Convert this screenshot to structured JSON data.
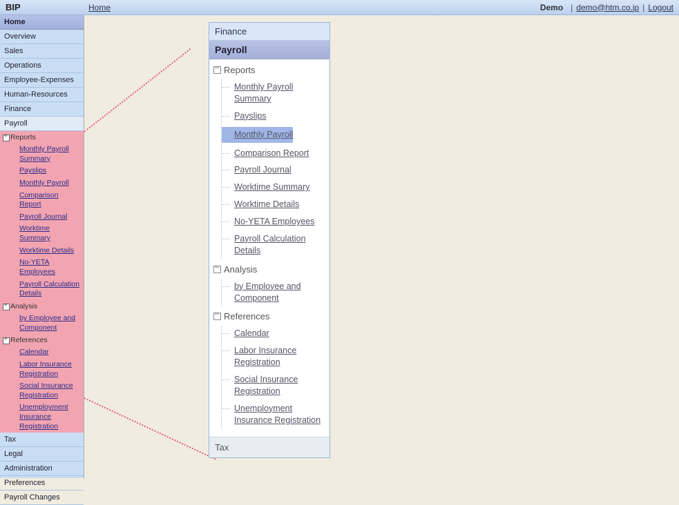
{
  "header": {
    "app_title": "BIP",
    "home_link": "Home",
    "user_name": "Demo",
    "email": "demo@htm.co.jp",
    "logout": "Logout"
  },
  "sidebar": {
    "home_label": "Home",
    "items": [
      "Overview",
      "Sales",
      "Operations",
      "Employee-Expenses",
      "Human-Resources",
      "Finance",
      "Payroll"
    ],
    "payroll_sub": {
      "reports": {
        "title": "Reports",
        "links": [
          "Monthly Payroll Summary",
          "Payslips",
          "Monthly Payroll",
          "Comparison Report",
          "Payroll Journal",
          "Worktime Summary",
          "Worktime Details",
          "No-YETA Employees",
          "Payroll Calculation Details"
        ]
      },
      "analysis": {
        "title": "Analysis",
        "links": [
          "by Employee and Component"
        ]
      },
      "references": {
        "title": "References",
        "links": [
          "Calendar",
          "Labor Insurance Registration",
          "Social Insurance Registration",
          "Unemployment Insurance Registration"
        ]
      }
    },
    "tail_items": [
      "Tax",
      "Legal",
      "Administration",
      "Preferences",
      "Payroll Changes"
    ]
  },
  "panel": {
    "finance_label": "Finance",
    "payroll_label": "Payroll",
    "reports": {
      "title": "Reports",
      "links": [
        "Monthly Payroll Summary",
        "Payslips",
        "Monthly Payroll",
        "Comparison Report",
        "Payroll Journal",
        "Worktime Summary",
        "Worktime Details",
        "No-YETA Employees",
        "Payroll Calculation Details"
      ],
      "highlighted_index": 2
    },
    "analysis": {
      "title": "Analysis",
      "links": [
        "by Employee and Component"
      ]
    },
    "references": {
      "title": "References",
      "links": [
        "Calendar",
        "Labor Insurance Registration",
        "Social Insurance Registration",
        "Unemployment Insurance Registration"
      ]
    },
    "tax_label": "Tax"
  }
}
